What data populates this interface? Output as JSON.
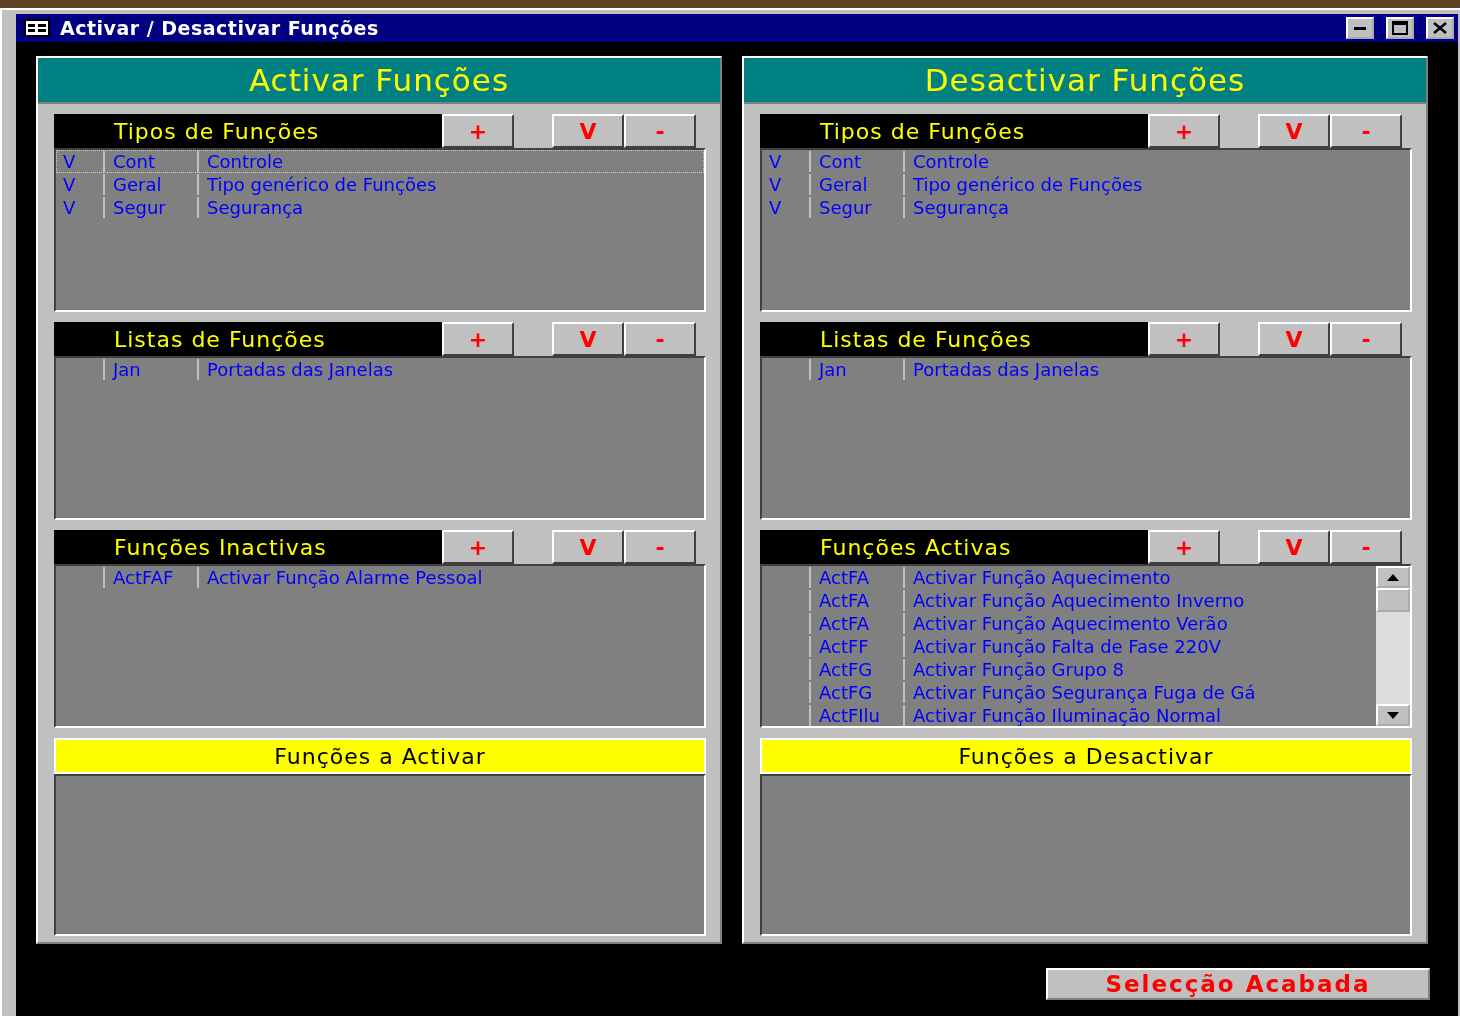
{
  "window": {
    "title": "Activar / Desactivar Funções"
  },
  "panels": [
    {
      "title": "Activar Funções",
      "sections": [
        {
          "title": "Tipos de Funções",
          "buttons": [
            "+",
            "V",
            "-"
          ],
          "scrollable": false,
          "rows": [
            {
              "flag": "V",
              "code": "Cont",
              "description": "Controle",
              "selected": true
            },
            {
              "flag": "V",
              "code": "Geral",
              "description": "Tipo genérico de Funções",
              "selected": false
            },
            {
              "flag": "V",
              "code": "Segur",
              "description": "Segurança",
              "selected": false
            }
          ]
        },
        {
          "title": "Listas de Funções",
          "buttons": [
            "+",
            "V",
            "-"
          ],
          "scrollable": false,
          "rows": [
            {
              "code": "Jan",
              "description": "Portadas das Janelas",
              "selected": false
            }
          ]
        },
        {
          "title": "Funções Inactivas",
          "buttons": [
            "+",
            "V",
            "-"
          ],
          "scrollable": false,
          "rows": [
            {
              "code": "ActFAF",
              "description": "Activar Função Alarme Pessoal",
              "selected": false
            }
          ]
        }
      ],
      "selection": {
        "title": "Funções a Activar"
      }
    },
    {
      "title": "Desactivar Funções",
      "sections": [
        {
          "title": "Tipos de Funções",
          "buttons": [
            "+",
            "V",
            "-"
          ],
          "scrollable": false,
          "rows": [
            {
              "flag": "V",
              "code": "Cont",
              "description": "Controle",
              "selected": false
            },
            {
              "flag": "V",
              "code": "Geral",
              "description": "Tipo genérico de Funções",
              "selected": false
            },
            {
              "flag": "V",
              "code": "Segur",
              "description": "Segurança",
              "selected": false
            }
          ]
        },
        {
          "title": "Listas de Funções",
          "buttons": [
            "+",
            "V",
            "-"
          ],
          "scrollable": false,
          "rows": [
            {
              "code": "Jan",
              "description": "Portadas das Janelas",
              "selected": false
            }
          ]
        },
        {
          "title": "Funções Activas",
          "buttons": [
            "+",
            "V",
            "-"
          ],
          "scrollable": true,
          "rows": [
            {
              "code": "ActFA",
              "description": "Activar Função Aquecimento",
              "selected": false
            },
            {
              "code": "ActFA",
              "description": "Activar Função Aquecimento Inverno",
              "selected": false
            },
            {
              "code": "ActFA",
              "description": "Activar Função Aquecimento Verão",
              "selected": false
            },
            {
              "code": "ActFF",
              "description": "Activar Função Falta de Fase 220V",
              "selected": false
            },
            {
              "code": "ActFG",
              "description": "Activar Função Grupo 8",
              "selected": false
            },
            {
              "code": "ActFG",
              "description": "Activar Função Segurança Fuga de Gá",
              "selected": false
            },
            {
              "code": "ActFIlu",
              "description": "Activar Função Iluminação Normal",
              "selected": false
            }
          ]
        }
      ],
      "selection": {
        "title": "Funções a Desactivar"
      }
    }
  ],
  "footer_button": "Selecção Acabada"
}
